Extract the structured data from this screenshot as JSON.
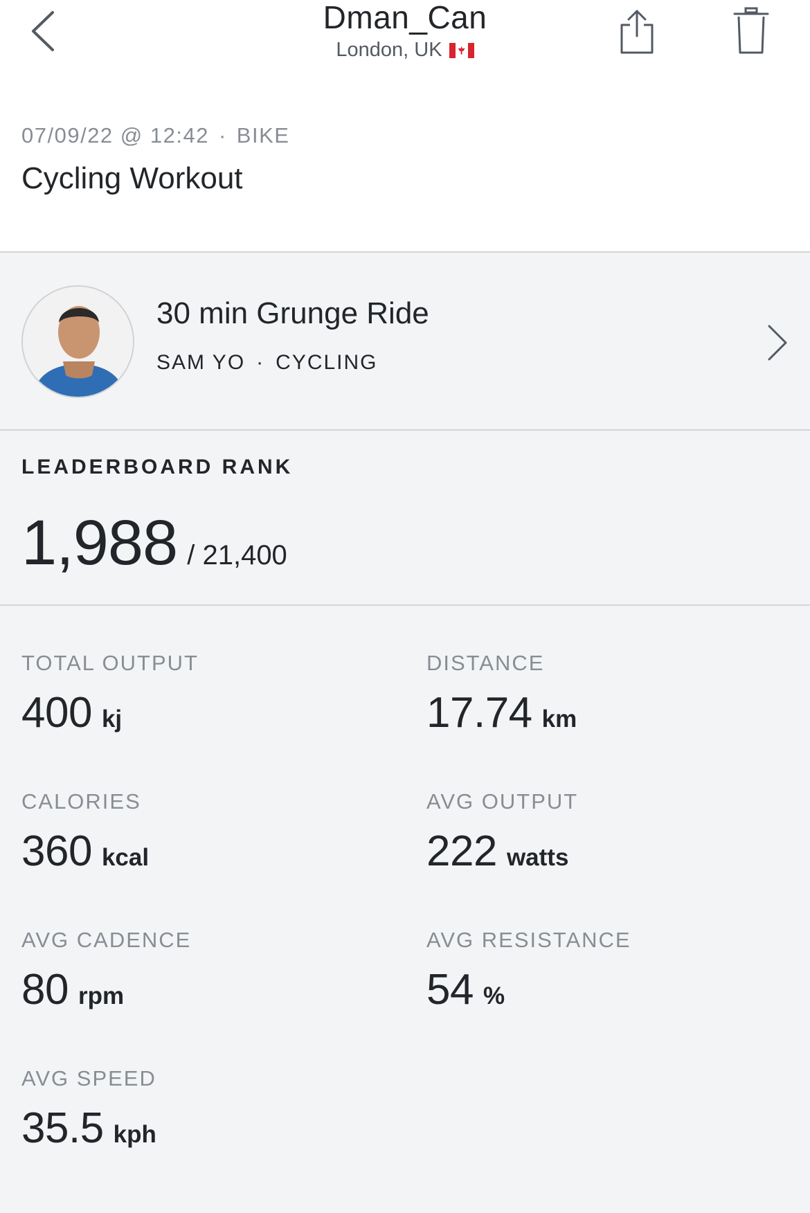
{
  "header": {
    "user_name": "Dman_Can",
    "location": "London, UK",
    "flag_icon": "canada-flag-icon",
    "back_icon": "chevron-left-icon",
    "share_icon": "share-icon",
    "delete_icon": "trash-icon"
  },
  "workout": {
    "date": "07/09/22 @ 12:42",
    "separator": "·",
    "type": "BIKE",
    "title": "Cycling Workout"
  },
  "class": {
    "title": "30 min Grunge Ride",
    "instructor": "SAM YO",
    "separator": "·",
    "discipline": "CYCLING",
    "chevron_icon": "chevron-right-icon"
  },
  "leaderboard": {
    "label": "LEADERBOARD RANK",
    "rank": "1,988",
    "total": "/ 21,400"
  },
  "metrics": [
    {
      "label": "TOTAL OUTPUT",
      "value": "400",
      "unit": "kj"
    },
    {
      "label": "DISTANCE",
      "value": "17.74",
      "unit": "km"
    },
    {
      "label": "CALORIES",
      "value": "360",
      "unit": "kcal"
    },
    {
      "label": "AVG OUTPUT",
      "value": "222",
      "unit": "watts"
    },
    {
      "label": "AVG CADENCE",
      "value": "80",
      "unit": "rpm"
    },
    {
      "label": "AVG RESISTANCE",
      "value": "54",
      "unit": "%"
    },
    {
      "label": "AVG SPEED",
      "value": "35.5",
      "unit": "kph"
    }
  ],
  "colors": {
    "background": "#f3f4f6",
    "header_background": "#ffffff",
    "text": "#222529",
    "muted_text": "#888d94",
    "divider": "#d3d5d8",
    "flag_red": "#d9232e"
  }
}
